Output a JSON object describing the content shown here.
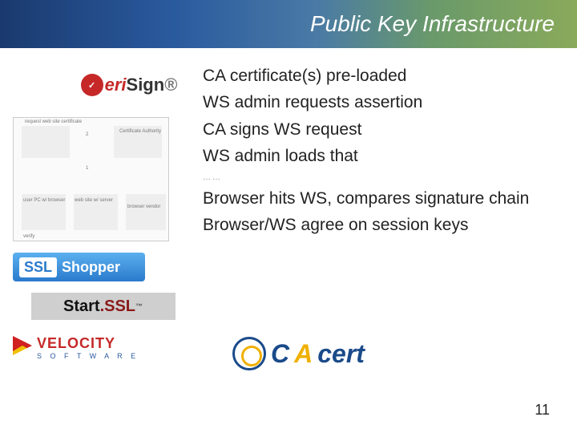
{
  "header": {
    "title": "Public Key Infrastructure"
  },
  "bullets": {
    "b1": "CA certificate(s) pre-loaded",
    "b2": "WS admin requests assertion",
    "b3": "CA signs WS request",
    "b4": "WS admin loads that",
    "divider": "……",
    "b5": "Browser hits WS, compares signature chain",
    "b6": "Browser/WS agree on session keys"
  },
  "logos": {
    "verisign": {
      "name": "VeriSign"
    },
    "diagram": {
      "name": "PKI flow diagram"
    },
    "sslshopper": {
      "ssl": "SSL",
      "shopper": "Shopper"
    },
    "startssl": {
      "start": "Start",
      "ssl": ".SSL",
      "tm": "™"
    },
    "velocity": {
      "main": "VELOCITY",
      "sub": "S O F T W A R E"
    },
    "cacert": {
      "c1": "C",
      "a1": "A",
      "rest": "cert"
    }
  },
  "page_number": "11"
}
